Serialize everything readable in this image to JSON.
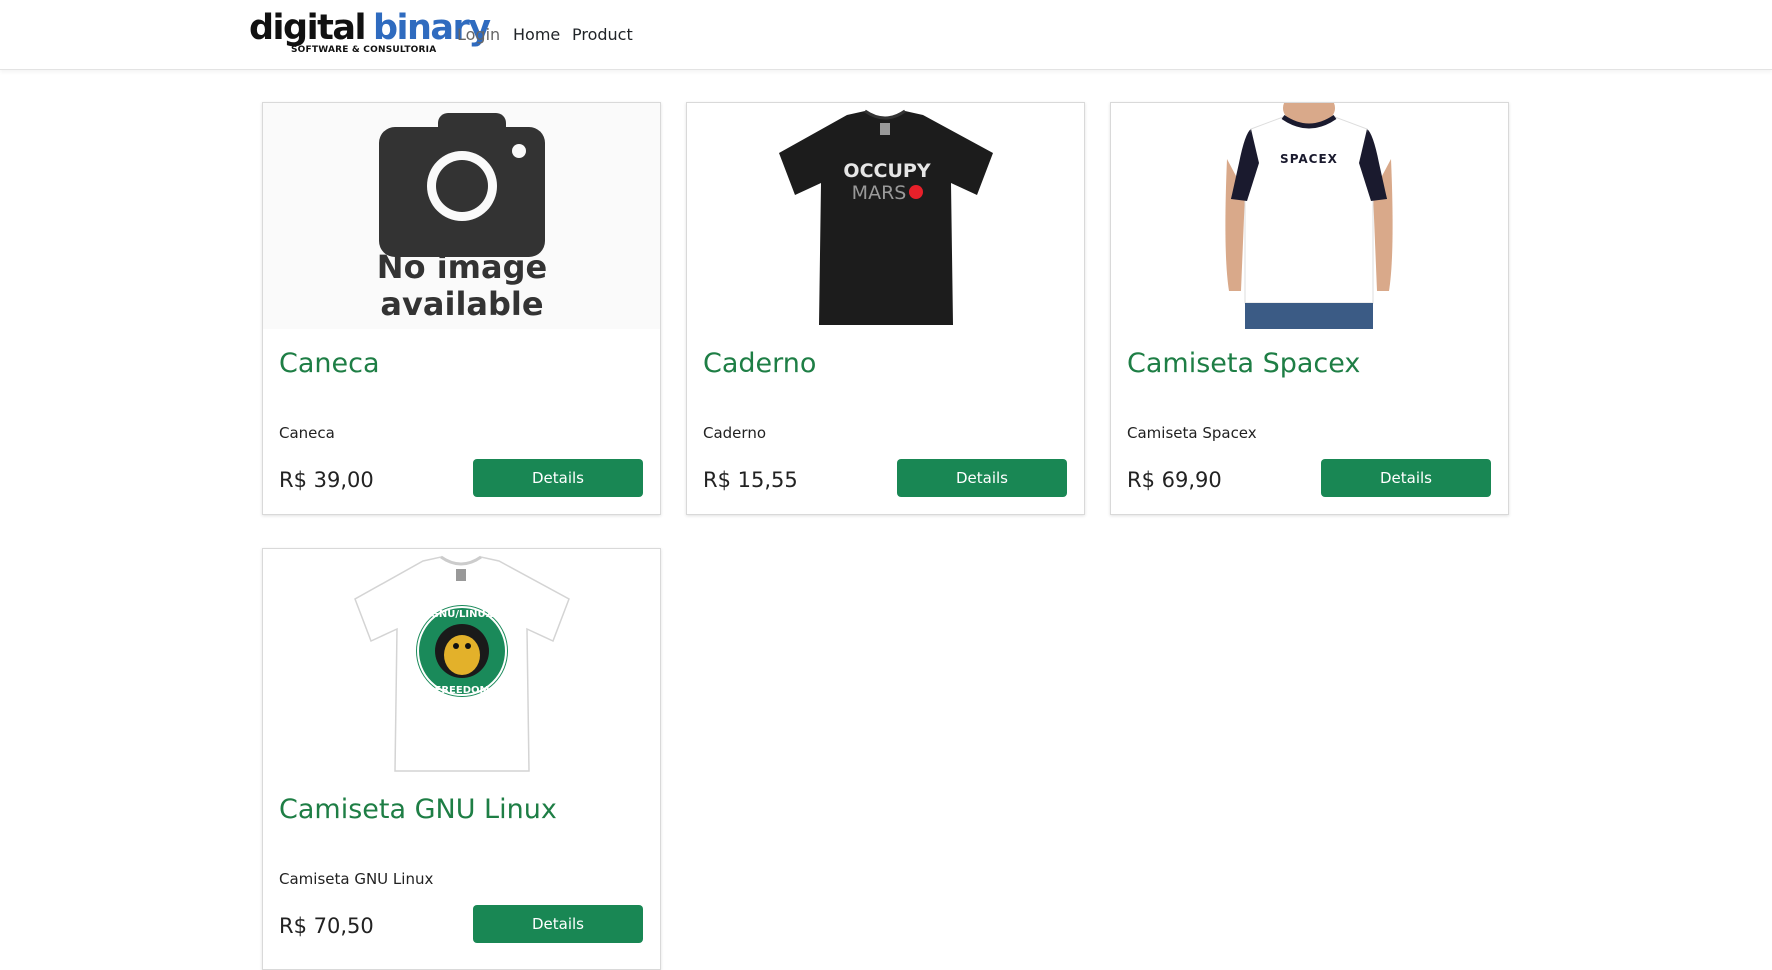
{
  "brand": {
    "name_part1": "digital",
    "name_part2": "binary",
    "tagline": "SOFTWARE & CONSULTORIA",
    "colors": {
      "dark": "#111111",
      "blue": "#2f6bbf"
    }
  },
  "nav": {
    "items": [
      {
        "label": "Login"
      },
      {
        "label": "Home"
      },
      {
        "label": "Product"
      }
    ]
  },
  "theme": {
    "accent": "#198754",
    "title_color": "#1e7e45"
  },
  "products": [
    {
      "title": "Caneca",
      "description": "Caneca",
      "price": "R$ 39,00",
      "button_label": "Details",
      "image": {
        "icon": "no-image-placeholder",
        "line1": "No image",
        "line2": "available"
      }
    },
    {
      "title": "Caderno",
      "description": "Caderno",
      "price": "R$ 15,55",
      "button_label": "Details",
      "image": {
        "icon": "black-tshirt-occupy-mars",
        "line1": "OCCUPY",
        "line2": "MARS"
      }
    },
    {
      "title": "Camiseta Spacex",
      "description": "Camiseta Spacex",
      "price": "R$ 69,90",
      "button_label": "Details",
      "image": {
        "icon": "man-in-white-raglan-tshirt",
        "line1": "SPACEX"
      }
    },
    {
      "title": "Camiseta GNU Linux",
      "description": "Camiseta GNU Linux",
      "price": "R$ 70,50",
      "button_label": "Details",
      "image": {
        "icon": "white-tshirt-gnu-linux-freedom",
        "line1": "GNU/LINUX",
        "line2": "FREEDOM"
      }
    }
  ]
}
